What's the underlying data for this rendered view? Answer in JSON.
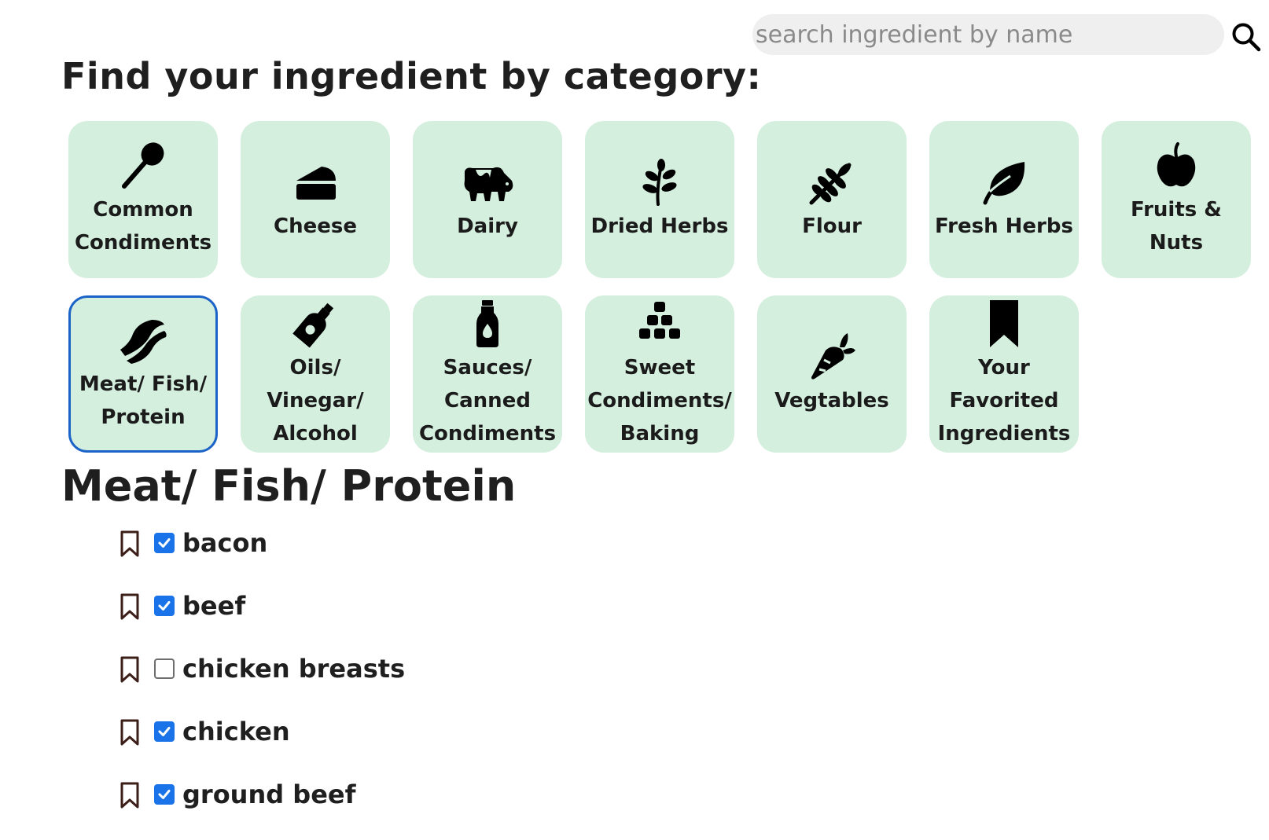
{
  "search": {
    "placeholder": "search ingredient by name",
    "value": "",
    "icon": "search-icon"
  },
  "page_title": "Find your ingredient by category:",
  "categories": [
    {
      "label": "Common Condiments",
      "icon": "spoon-icon",
      "selected": false
    },
    {
      "label": "Cheese",
      "icon": "cheese-icon",
      "selected": false
    },
    {
      "label": "Dairy",
      "icon": "cow-icon",
      "selected": false
    },
    {
      "label": "Dried Herbs",
      "icon": "herb-sprig-icon",
      "selected": false
    },
    {
      "label": "Flour",
      "icon": "wheat-icon",
      "selected": false
    },
    {
      "label": "Fresh Herbs",
      "icon": "leaf-icon",
      "selected": false
    },
    {
      "label": "Fruits & Nuts",
      "icon": "apple-icon",
      "selected": false
    },
    {
      "label": "Meat/ Fish/ Protein",
      "icon": "bacon-icon",
      "selected": true
    },
    {
      "label": "Oils/ Vinegar/ Alcohol",
      "icon": "bottle-icon",
      "selected": false
    },
    {
      "label": "Sauces/ Canned Condiments",
      "icon": "sauce-bottle-icon",
      "selected": false
    },
    {
      "label": "Sweet Condiments/ Baking",
      "icon": "sugar-cubes-icon",
      "selected": false
    },
    {
      "label": "Vegtables",
      "icon": "carrot-icon",
      "selected": false
    },
    {
      "label": "Your Favorited Ingredients",
      "icon": "bookmark-icon",
      "selected": false
    }
  ],
  "section_title": "Meat/ Fish/ Protein",
  "ingredients": [
    {
      "name": "bacon",
      "checked": true,
      "bookmarked": false
    },
    {
      "name": "beef",
      "checked": true,
      "bookmarked": false
    },
    {
      "name": "chicken breasts",
      "checked": false,
      "bookmarked": false
    },
    {
      "name": "chicken",
      "checked": true,
      "bookmarked": false
    },
    {
      "name": "ground beef",
      "checked": true,
      "bookmarked": false
    }
  ],
  "colors": {
    "tile_bg": "#d4efde",
    "selected_border": "#1c63c8",
    "checkbox_checked": "#1a73e8",
    "bookmark_stroke": "#3b1f18",
    "search_bg": "#efefef"
  }
}
